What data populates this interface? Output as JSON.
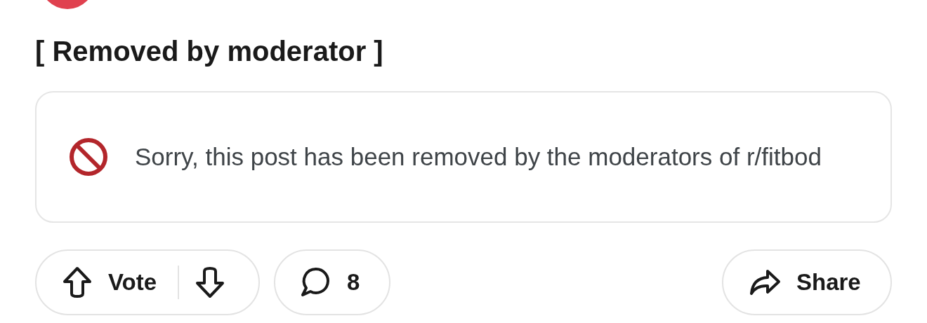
{
  "post": {
    "title": "[ Removed by moderator ]"
  },
  "notice": {
    "message": "Sorry, this post has been removed by the moderators of r/fitbod"
  },
  "actions": {
    "vote_label": "Vote",
    "comment_count": "8",
    "share_label": "Share"
  }
}
